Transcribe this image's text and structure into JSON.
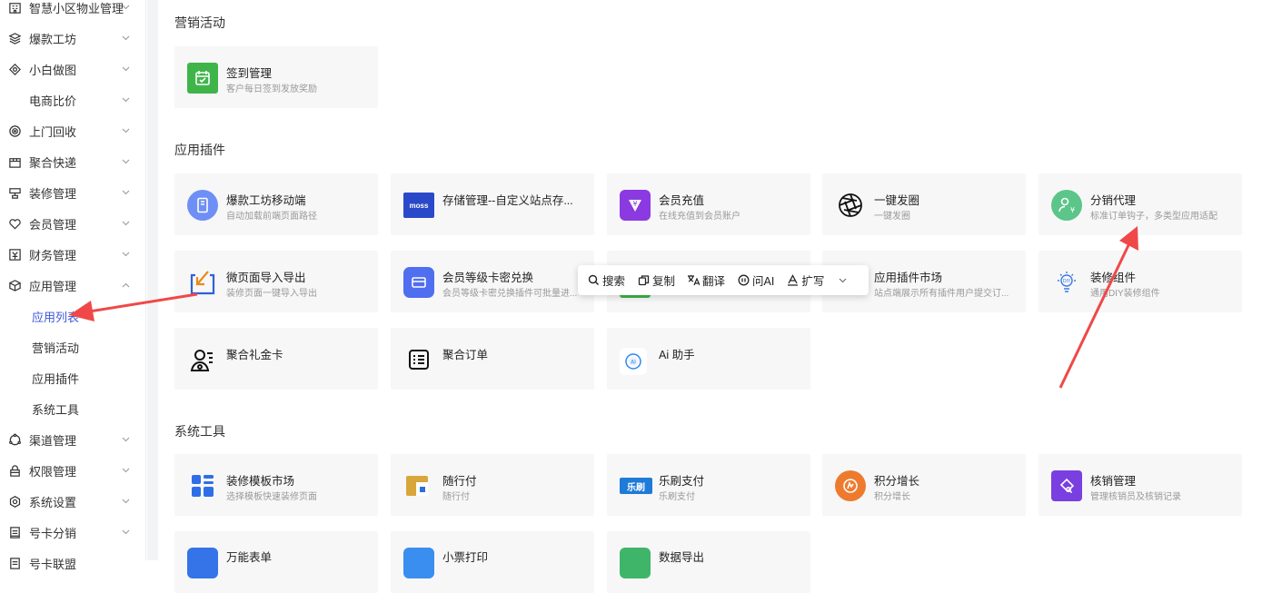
{
  "sidebar": {
    "items": [
      {
        "label": "智慧小区物业管理",
        "icon": "building-icon"
      },
      {
        "label": "爆款工坊",
        "icon": "layers-icon"
      },
      {
        "label": "小白做图",
        "icon": "palette-icon"
      },
      {
        "label": "电商比价",
        "icon": ""
      },
      {
        "label": "上门回收",
        "icon": "target-icon"
      },
      {
        "label": "聚合快递",
        "icon": "package-icon"
      },
      {
        "label": "装修管理",
        "icon": "brush-icon"
      },
      {
        "label": "会员管理",
        "icon": "heart-icon"
      },
      {
        "label": "财务管理",
        "icon": "finance-icon"
      },
      {
        "label": "应用管理",
        "icon": "cube-icon"
      },
      {
        "label": "应用列表",
        "icon": ""
      },
      {
        "label": "营销活动",
        "icon": ""
      },
      {
        "label": "应用插件",
        "icon": ""
      },
      {
        "label": "系统工具",
        "icon": ""
      },
      {
        "label": "渠道管理",
        "icon": "channel-icon"
      },
      {
        "label": "权限管理",
        "icon": "lock-icon"
      },
      {
        "label": "系统设置",
        "icon": "gear-icon"
      },
      {
        "label": "号卡分销",
        "icon": "card-icon"
      },
      {
        "label": "号卡联盟",
        "icon": "card-icon"
      }
    ]
  },
  "sections": {
    "marketing": "营销活动",
    "plugins": "应用插件",
    "tools": "系统工具"
  },
  "cards": {
    "signin": {
      "title": "签到管理",
      "desc": "客户每日签到发放奖励"
    },
    "baokuan": {
      "title": "爆款工坊移动端",
      "desc": "自动加载前端页面路径"
    },
    "storage": {
      "title": "存储管理--自定义站点存...",
      "desc": "",
      "icon_text": "moss"
    },
    "recharge": {
      "title": "会员充值",
      "desc": "在线充值到会员账户"
    },
    "moments": {
      "title": "一键发圈",
      "desc": "一键发圈"
    },
    "distribution": {
      "title": "分销代理",
      "desc": "标准订单钩子，多类型应用适配"
    },
    "importexport": {
      "title": "微页面导入导出",
      "desc": "装修页面一键导入导出"
    },
    "cardcode": {
      "title": "会员等级卡密兑换",
      "desc": "会员等级卡密兑换插件可批量进..."
    },
    "market": {
      "title": "应用插件市场",
      "desc": "站点端展示所有插件用户提交订..."
    },
    "diycomp": {
      "title": "装修组件",
      "desc": "通用DIY装修组件"
    },
    "giftcard": {
      "title": "聚合礼金卡",
      "desc": ""
    },
    "order": {
      "title": "聚合订单",
      "desc": ""
    },
    "ai": {
      "title": "Ai 助手",
      "desc": ""
    },
    "tplmarket": {
      "title": "装修模板市场",
      "desc": "选择模板快速装修页面"
    },
    "suixingfu": {
      "title": "随行付",
      "desc": "随行付"
    },
    "leshua": {
      "title": "乐刷支付",
      "desc": "乐刷支付",
      "icon_text": "乐刷"
    },
    "points": {
      "title": "积分增长",
      "desc": "积分增长"
    },
    "verify": {
      "title": "核销管理",
      "desc": "管理核销员及核销记录"
    },
    "form": {
      "title": "万能表单",
      "desc": ""
    },
    "receipt": {
      "title": "小票打印",
      "desc": ""
    },
    "export": {
      "title": "数据导出",
      "desc": ""
    }
  },
  "toolbar": {
    "search": "搜索",
    "copy": "复制",
    "translate": "翻译",
    "ask_ai": "问AI",
    "expand": "扩写"
  },
  "colors": {
    "accent": "#3a57d8",
    "annotation_arrow": "#f04848",
    "card_bg": "#f7f7f8"
  }
}
